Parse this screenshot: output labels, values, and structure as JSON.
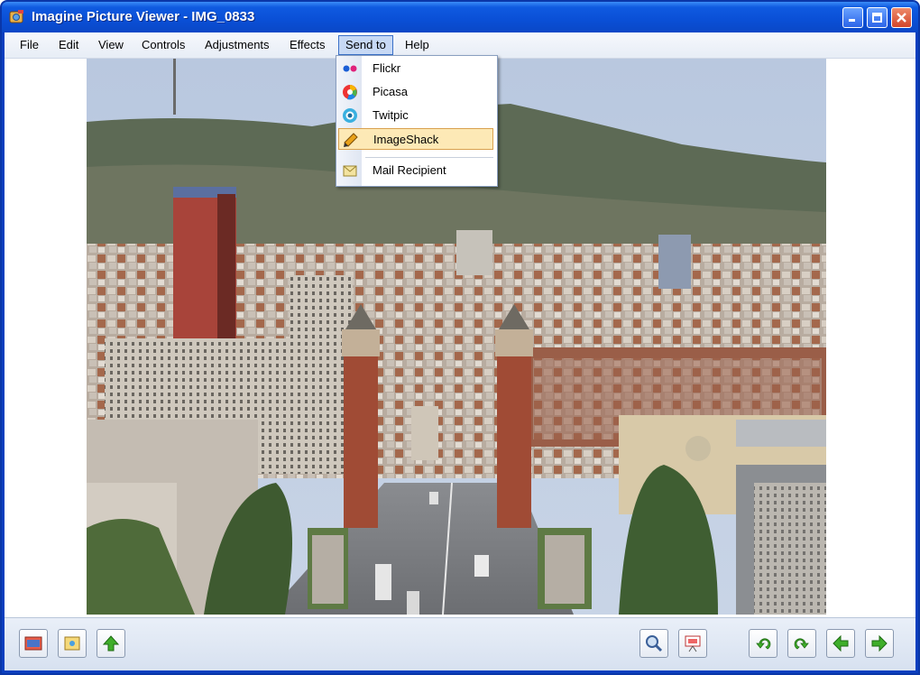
{
  "window": {
    "title": "Imagine Picture Viewer - IMG_0833"
  },
  "menu": {
    "items": [
      {
        "label": "File"
      },
      {
        "label": "Edit"
      },
      {
        "label": "View"
      },
      {
        "label": "Controls"
      },
      {
        "label": "Adjustments"
      },
      {
        "label": "Effects"
      },
      {
        "label": "Send to",
        "active": true
      },
      {
        "label": "Help"
      }
    ]
  },
  "send_to_menu": {
    "items": [
      {
        "label": "Flickr",
        "icon": "flickr-icon"
      },
      {
        "label": "Picasa",
        "icon": "picasa-icon"
      },
      {
        "label": "Twitpic",
        "icon": "twitpic-icon"
      },
      {
        "label": "ImageShack",
        "icon": "imageshack-icon",
        "highlighted": true
      },
      {
        "label": "Mail Recipient",
        "icon": "mail-recipient-icon"
      }
    ]
  },
  "toolbar": {
    "left": [
      "slideshow-icon",
      "save-icon",
      "upload-icon"
    ],
    "middle": [
      "zoom-icon",
      "presentation-icon"
    ],
    "right": [
      "rotate-left-icon",
      "rotate-right-icon",
      "previous-icon",
      "next-icon"
    ]
  },
  "colors": {
    "titlebar": "#0a4fd6",
    "menu_highlight": "#fde9b6",
    "toolbar_green": "#3fae2a"
  }
}
